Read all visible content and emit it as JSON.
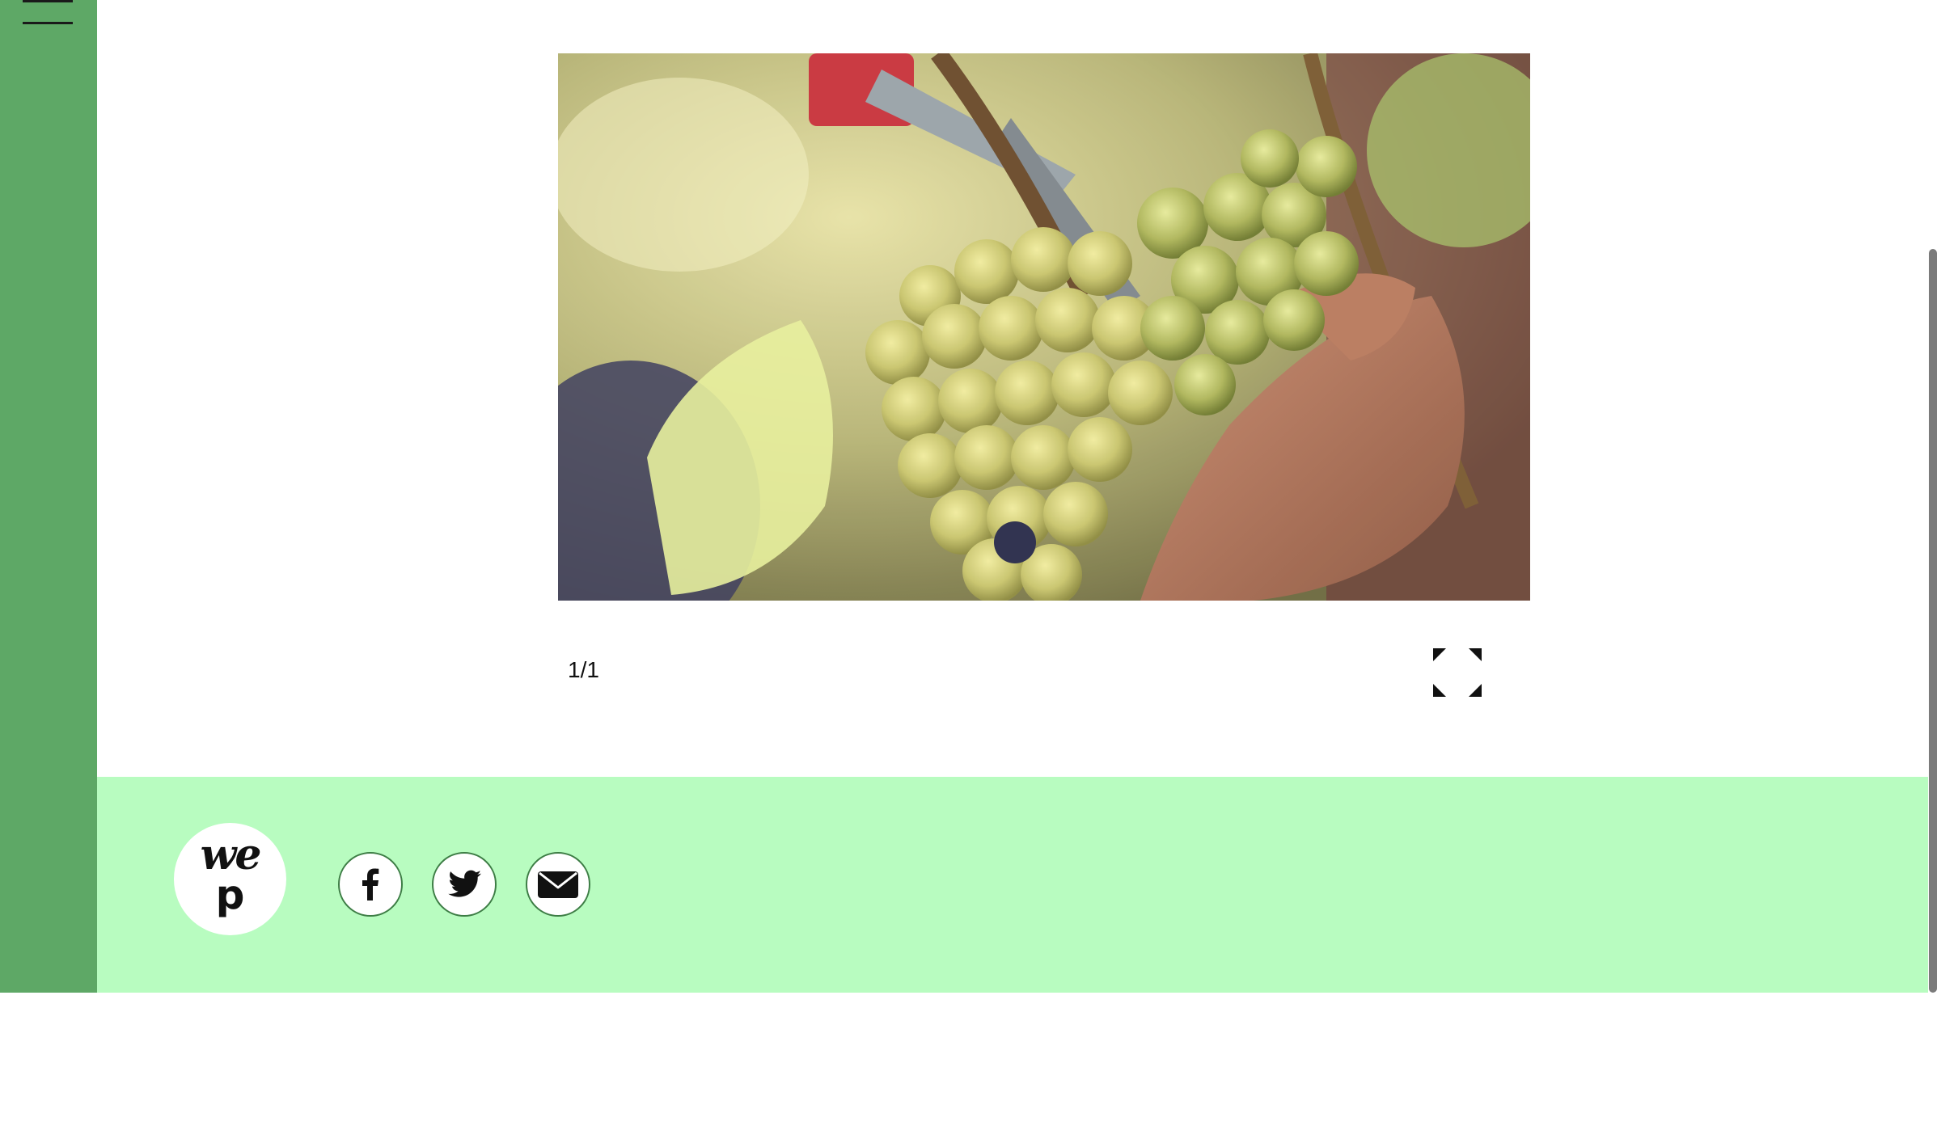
{
  "sidebar": {
    "menu_icon": "hamburger-menu-icon",
    "color": "#5ea866"
  },
  "slideshow": {
    "image_description_icon": "photo",
    "counter": "1/1",
    "fullscreen_icon": "expand-fullscreen-icon"
  },
  "footer": {
    "color": "#b8fcc0",
    "logo": {
      "line1": "we",
      "line2": "p"
    },
    "social": [
      {
        "icon": "facebook-icon"
      },
      {
        "icon": "twitter-icon"
      },
      {
        "icon": "email-icon"
      }
    ]
  }
}
